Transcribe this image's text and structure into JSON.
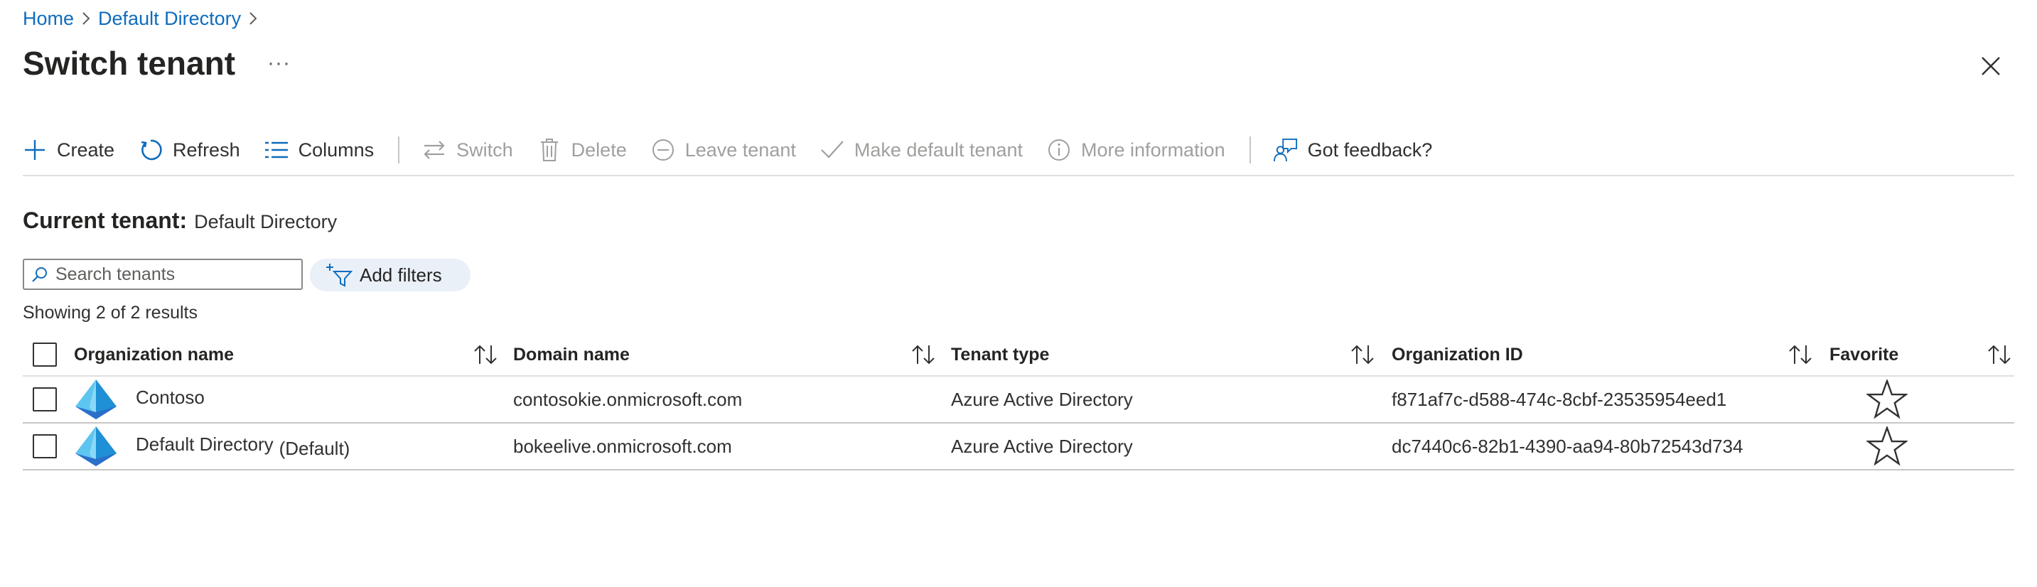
{
  "breadcrumb": {
    "home": "Home",
    "directory": "Default Directory"
  },
  "page": {
    "title": "Switch tenant",
    "more": "···"
  },
  "toolbar": {
    "create": "Create",
    "refresh": "Refresh",
    "columns": "Columns",
    "switch": "Switch",
    "delete": "Delete",
    "leave": "Leave tenant",
    "make_default": "Make default tenant",
    "more_info": "More information",
    "feedback": "Got feedback?"
  },
  "current_tenant": {
    "label": "Current tenant:",
    "value": "Default Directory"
  },
  "search": {
    "placeholder": "Search tenants",
    "value": ""
  },
  "filters": {
    "label": "Add filters"
  },
  "results": "Showing 2 of 2 results",
  "table": {
    "columns": [
      "Organization name",
      "Domain name",
      "Tenant type",
      "Organization ID",
      "Favorite"
    ],
    "rows": [
      {
        "name": "Contoso",
        "suffix": "",
        "domain": "contosokie.onmicrosoft.com",
        "type": "Azure Active Directory",
        "org_id": "f871af7c-d588-474c-8cbf-23535954eed1",
        "favorite": false
      },
      {
        "name": "Default Directory",
        "suffix": "(Default)",
        "domain": "bokeelive.onmicrosoft.com",
        "type": "Azure Active Directory",
        "org_id": "dc7440c6-82b1-4390-aa94-80b72543d734",
        "favorite": false
      }
    ]
  },
  "colors": {
    "link": "#0f6cbd",
    "disabled": "#a19f9d",
    "filter_pill": "#eaf0f8"
  }
}
